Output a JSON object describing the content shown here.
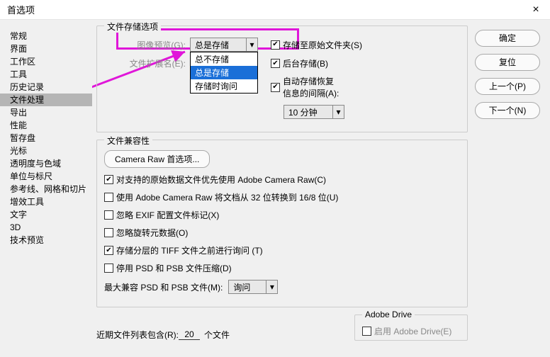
{
  "title": "首选项",
  "close_glyph": "×",
  "sidebar": {
    "items": [
      "常规",
      "界面",
      "工作区",
      "工具",
      "历史记录",
      "文件处理",
      "导出",
      "性能",
      "暂存盘",
      "光标",
      "透明度与色域",
      "单位与标尺",
      "参考线、网格和切片",
      "增效工具",
      "文字",
      "3D",
      "技术预览"
    ],
    "selected_index": 5
  },
  "right_buttons": {
    "ok": "确定",
    "reset": "复位",
    "prev": "上一个(P)",
    "next": "下一个(N)"
  },
  "file_save": {
    "group_title": "文件存储选项",
    "image_preview_label": "图像预览(G):",
    "image_preview_value": "总是存储",
    "image_preview_options": [
      "总不存储",
      "总是存储",
      "存储时询问"
    ],
    "image_preview_selected_idx": 1,
    "file_ext_label": "文件扩展名(E):",
    "save_original_cb_label": "存储至原始文件夹(S)",
    "background_save_cb_label": "后台存储(B)",
    "auto_recover_label1": "自动存储恢复",
    "auto_recover_label2": "信息的间隔(A):",
    "auto_recover_value": "10 分钟"
  },
  "file_compat": {
    "group_title": "文件兼容性",
    "camera_raw_btn": "Camera Raw 首选项...",
    "cr_priority": "对支持的原始数据文件优先使用 Adobe Camera Raw(C)",
    "cr_16to8": "使用 Adobe Camera Raw 将文档从 32 位转换到 16/8 位(U)",
    "ignore_exif": "忽略 EXIF 配置文件标记(X)",
    "ignore_rotate": "忽略旋转元数据(O)",
    "ask_tiff": "存储分层的 TIFF 文件之前进行询问 (T)",
    "disable_psd": "停用 PSD 和 PSB 文件压缩(D)",
    "max_compat_label": "最大兼容 PSD 和 PSB 文件(M):",
    "max_compat_value": "询问"
  },
  "recent": {
    "label": "近期文件列表包含(R):",
    "value": "20",
    "unit": "个文件"
  },
  "adobe_drive": {
    "group_title": "Adobe Drive",
    "enable_label": "启用 Adobe Drive(E)"
  }
}
